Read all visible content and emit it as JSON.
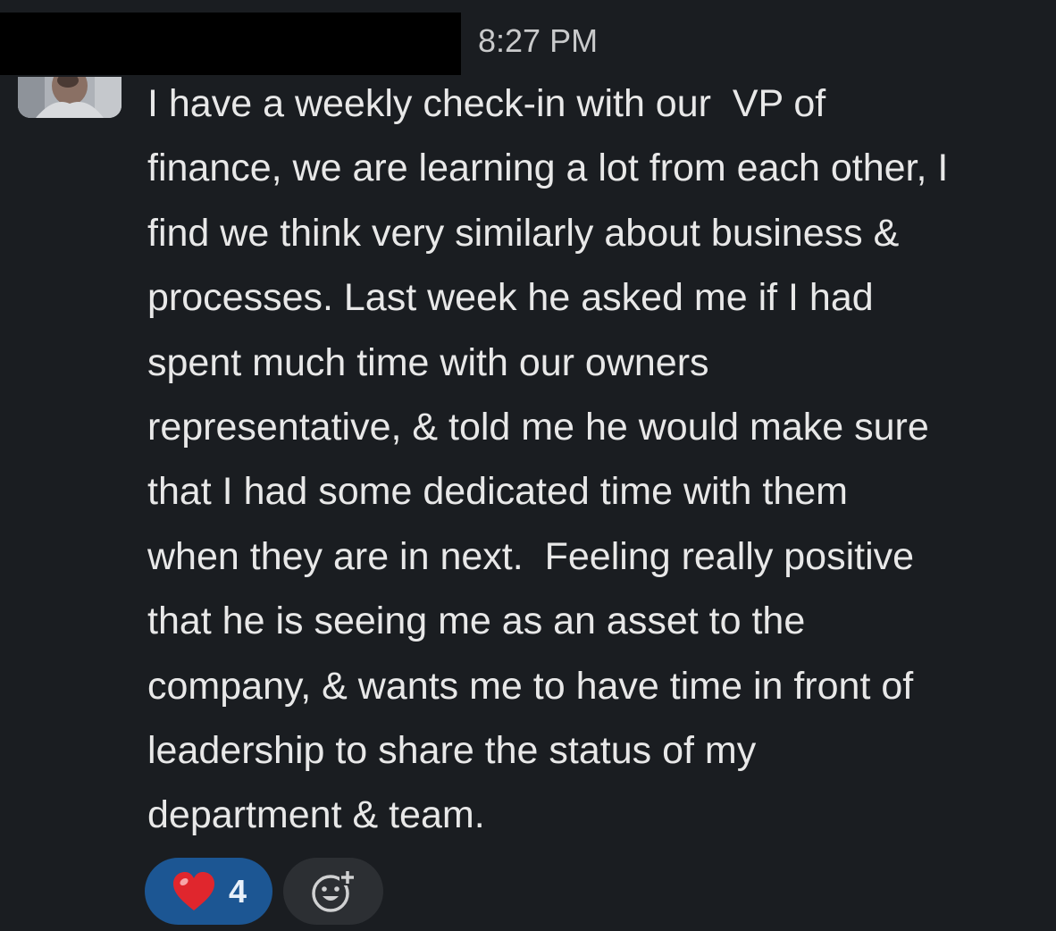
{
  "message": {
    "timestamp": "8:27 PM",
    "lines": [
      "I have a weekly check-in with our  VP of",
      "finance, we are learning a lot from each other, I",
      "find we think very similarly about business &",
      "processes. Last week he asked me if I had",
      "spent much time with our owners",
      "representative, & told me he would make sure",
      "that I had some dedicated time with them",
      "when they are in next.  Feeling really positive",
      "that he is seeing me as an asset to the",
      "company, & wants me to have time in front of",
      "leadership to share the status of my",
      "department & team."
    ]
  },
  "reactions": [
    {
      "emoji": "heart-icon",
      "count": "4",
      "color": "#e0262d"
    }
  ],
  "add_reaction": {
    "icon": "add-reaction-icon"
  },
  "colors": {
    "background": "#1a1d21",
    "text": "#e8e8e8",
    "reaction_active": "#1c5693",
    "reaction_idle": "#2c2f33"
  }
}
